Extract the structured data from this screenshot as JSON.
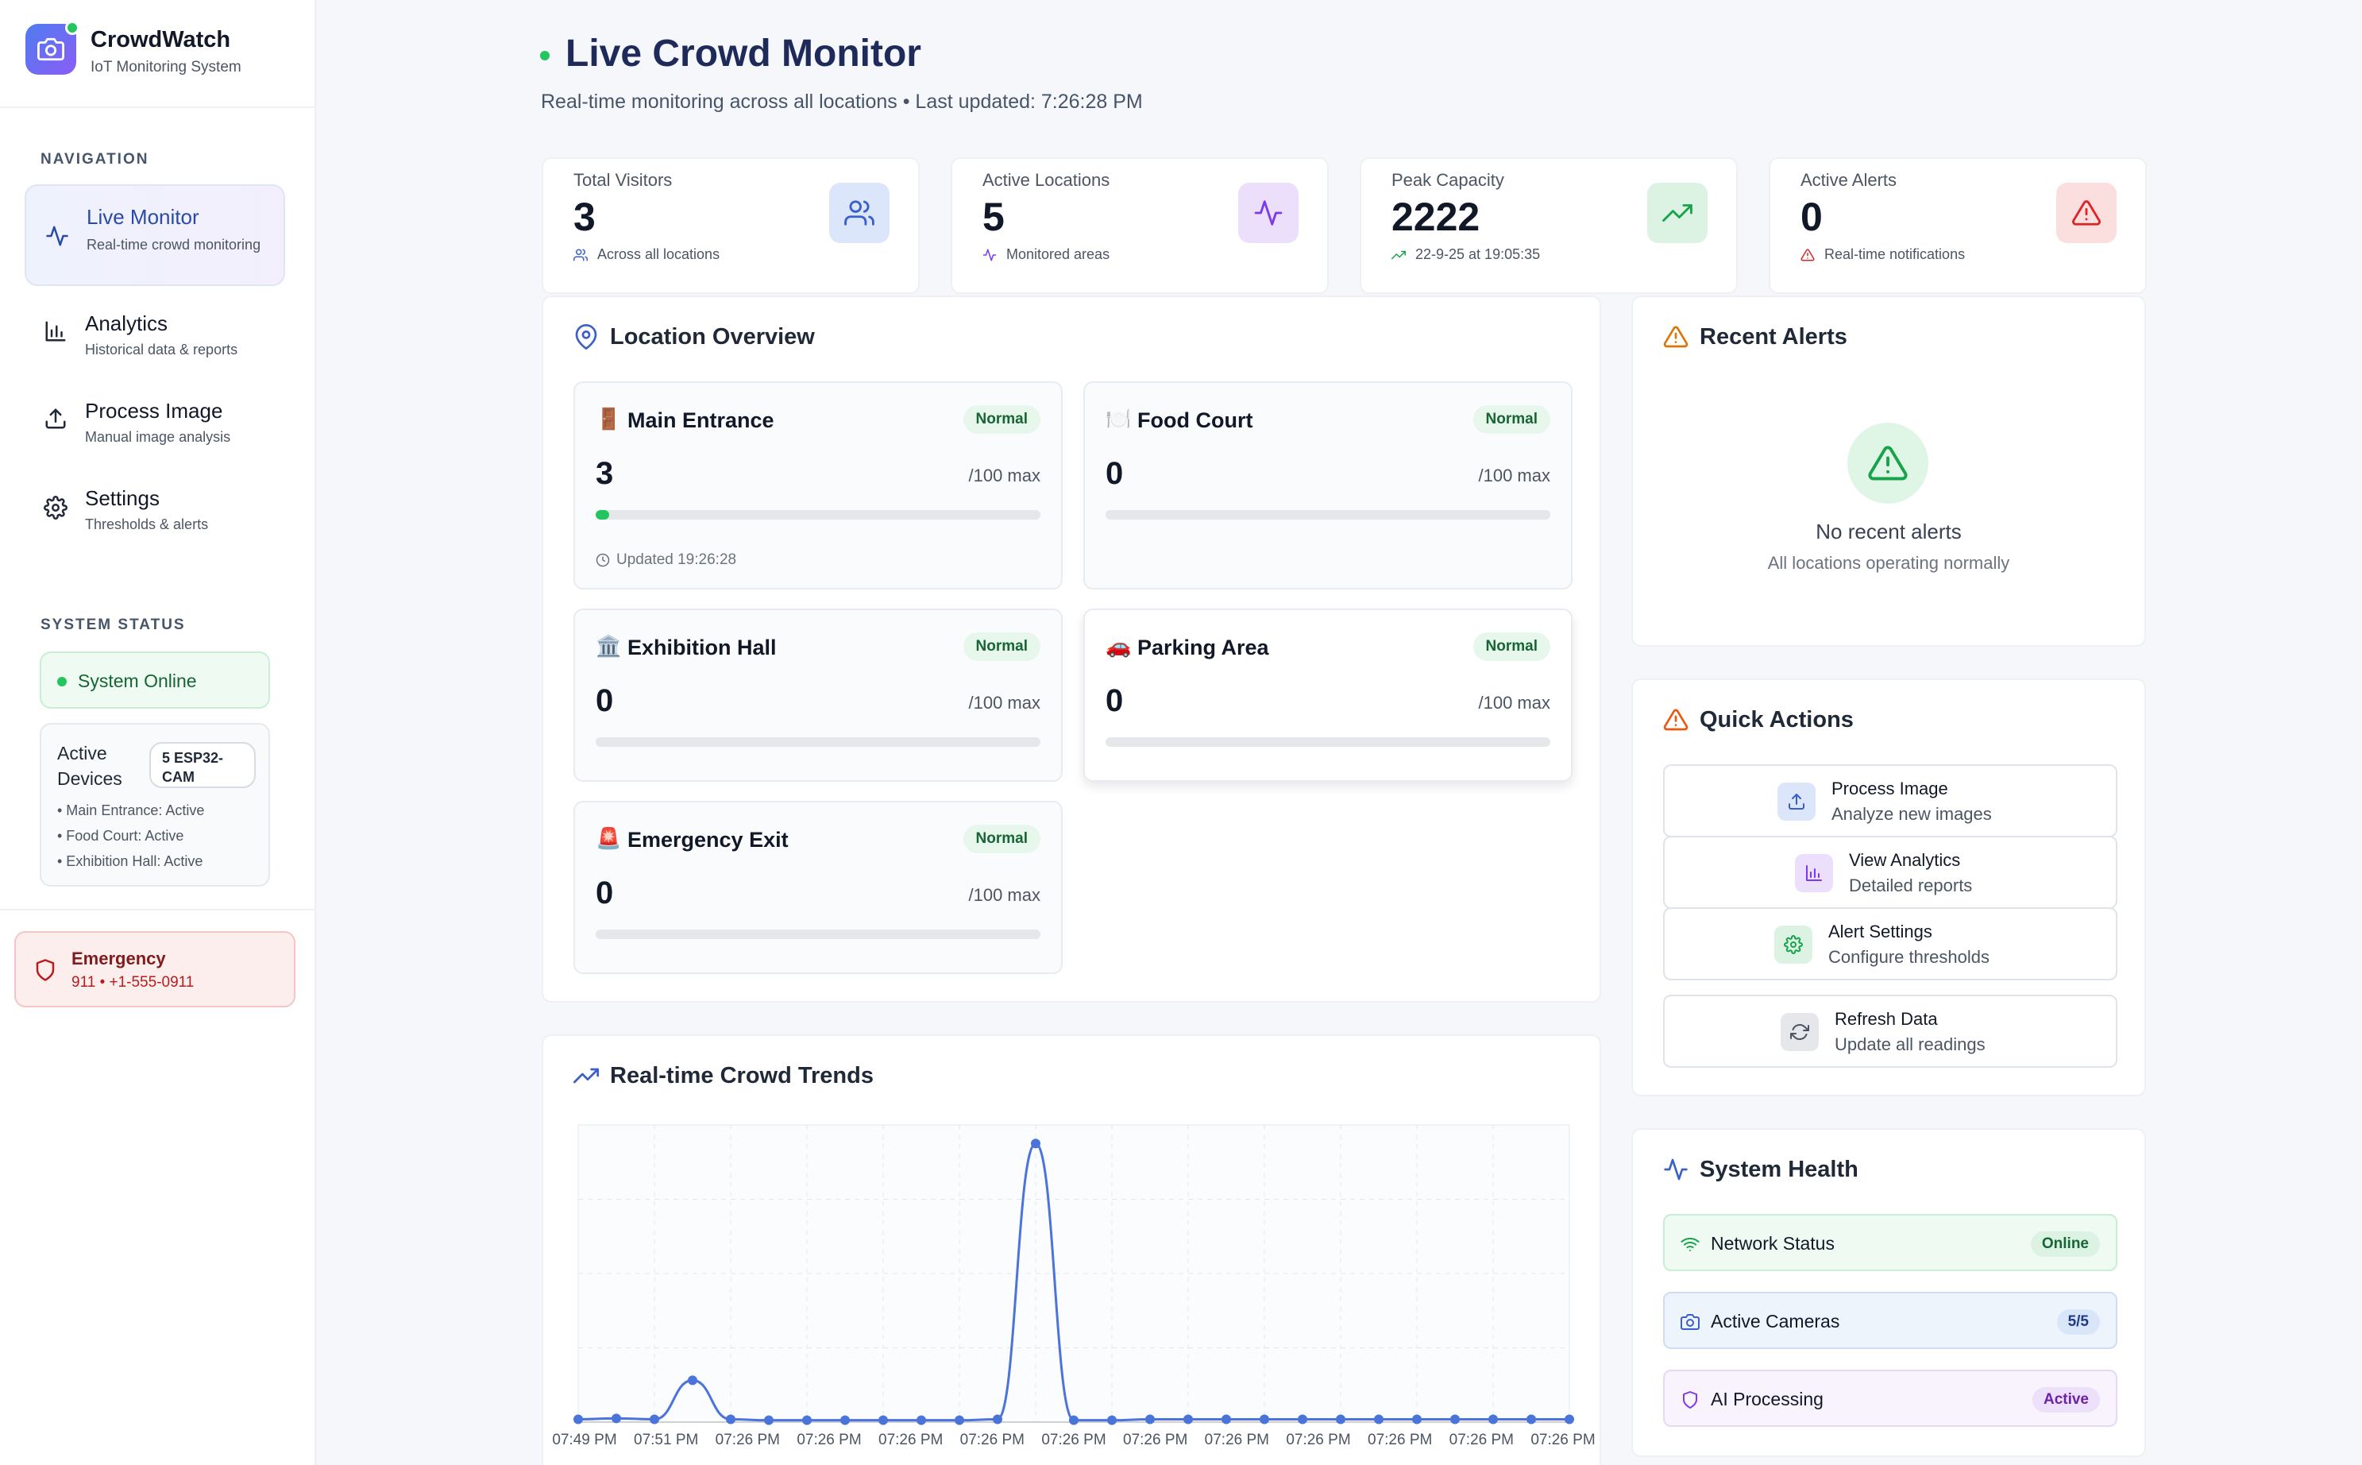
{
  "brand": {
    "title": "CrowdWatch",
    "subtitle": "IoT Monitoring System"
  },
  "sidebar": {
    "nav_label": "NAVIGATION",
    "items": [
      {
        "label": "Live Monitor",
        "desc": "Real-time crowd monitoring",
        "icon": "activity-icon",
        "active": true
      },
      {
        "label": "Analytics",
        "desc": "Historical data & reports",
        "icon": "bar-chart-icon",
        "active": false
      },
      {
        "label": "Process Image",
        "desc": "Manual image analysis",
        "icon": "upload-icon",
        "active": false
      },
      {
        "label": "Settings",
        "desc": "Thresholds & alerts",
        "icon": "gear-icon",
        "active": false
      }
    ],
    "status_label": "SYSTEM STATUS",
    "online_text": "System Online",
    "devices_title": "Active Devices",
    "devices_badge": "5 ESP32-CAM",
    "devices_lines": [
      "• Main Entrance: Active",
      "• Food Court: Active",
      "• Exhibition Hall: Active"
    ],
    "emergency_title": "Emergency",
    "emergency_numbers": "911 • +1-555-0911"
  },
  "header": {
    "title": "Live Crowd Monitor",
    "subtitle": "Real-time monitoring across all locations • Last updated: 7:26:28 PM"
  },
  "stats": [
    {
      "label": "Total Visitors",
      "value": "3",
      "foot": "Across all locations",
      "icon": "users-icon",
      "color": "#dbe6fb",
      "iconColor": "#3b5fc9"
    },
    {
      "label": "Active Locations",
      "value": "5",
      "foot": "Monitored areas",
      "icon": "activity-icon",
      "color": "#ebdffb",
      "iconColor": "#7c3aed"
    },
    {
      "label": "Peak Capacity",
      "value": "2222",
      "foot": "22-9-25 at 19:05:35",
      "icon": "trending-up-icon",
      "color": "#dcf3e4",
      "iconColor": "#16a34a"
    },
    {
      "label": "Active Alerts",
      "value": "0",
      "foot": "Real-time notifications",
      "icon": "alert-triangle-icon",
      "color": "#fbdede",
      "iconColor": "#dc2626"
    }
  ],
  "locations": {
    "title": "Location Overview",
    "items": [
      {
        "emoji": "🚪",
        "name": "Main Entrance",
        "status": "Normal",
        "count": "3",
        "max": "/100 max",
        "fill": 0.03,
        "updated": "Updated 19:26:28"
      },
      {
        "emoji": "🍽️",
        "name": "Food Court",
        "status": "Normal",
        "count": "0",
        "max": "/100 max",
        "fill": 0
      },
      {
        "emoji": "🏛️",
        "name": "Exhibition Hall",
        "status": "Normal",
        "count": "0",
        "max": "/100 max",
        "fill": 0
      },
      {
        "emoji": "🚗",
        "name": "Parking Area",
        "status": "Normal",
        "count": "0",
        "max": "/100 max",
        "fill": 0
      },
      {
        "emoji": "🚨",
        "name": "Emergency Exit",
        "status": "Normal",
        "count": "0",
        "max": "/100 max",
        "fill": 0
      }
    ]
  },
  "alerts": {
    "title": "Recent Alerts",
    "empty_title": "No recent alerts",
    "empty_sub": "All locations operating normally"
  },
  "quick_actions": {
    "title": "Quick Actions",
    "items": [
      {
        "label": "Process Image",
        "desc": "Analyze new images",
        "icon": "upload-icon",
        "color": "#dbe6fb",
        "iconColor": "#3b5fc9"
      },
      {
        "label": "View Analytics",
        "desc": "Detailed reports",
        "icon": "bar-chart-icon",
        "color": "#ebdffb",
        "iconColor": "#7c3aed"
      },
      {
        "label": "Alert Settings",
        "desc": "Configure thresholds",
        "icon": "gear-icon",
        "color": "#dcf3e4",
        "iconColor": "#16a34a"
      },
      {
        "label": "Refresh Data",
        "desc": "Update all readings",
        "icon": "refresh-icon",
        "color": "#e5e7eb",
        "iconColor": "#4b5563"
      }
    ]
  },
  "system_health": {
    "title": "System Health",
    "items": [
      {
        "label": "Network Status",
        "badge": "Online",
        "icon": "wifi-icon",
        "bg": "#effaf2",
        "border": "#c9eed5",
        "badgeBg": "#dcf3e4",
        "badgeColor": "#166534",
        "iconColor": "#16a34a"
      },
      {
        "label": "Active Cameras",
        "badge": "5/5",
        "icon": "camera-icon",
        "bg": "#eef4fc",
        "border": "#cfdcf1",
        "badgeBg": "#d9e5f9",
        "badgeColor": "#1e3a8a",
        "iconColor": "#3b5fc9"
      },
      {
        "label": "AI Processing",
        "badge": "Active",
        "icon": "shield-icon",
        "bg": "#f8f3fd",
        "border": "#e6d9f6",
        "badgeBg": "#ede0fb",
        "badgeColor": "#6b21a8",
        "iconColor": "#7c3aed"
      }
    ]
  },
  "trends": {
    "title": "Real-time Crowd Trends"
  },
  "chart_data": {
    "type": "line",
    "title": "Real-time Crowd Trends",
    "x": [
      "07:49 PM",
      "07:51 PM",
      "07:51 PM",
      "07:51 PM",
      "07:26 PM",
      "07:26 PM",
      "07:26 PM",
      "07:26 PM",
      "07:26 PM",
      "07:26 PM",
      "07:26 PM",
      "07:26 PM",
      "07:26 PM",
      "07:26 PM",
      "07:26 PM",
      "07:26 PM",
      "07:26 PM",
      "07:26 PM",
      "07:26 PM",
      "07:26 PM",
      "07:26 PM",
      "07:26 PM",
      "07:26 PM",
      "07:26 PM",
      "07:26 PM",
      "07:26 PM",
      "07:26 PM"
    ],
    "tick_labels": [
      "07:49 PM",
      "07:51 PM",
      "07:26 PM",
      "07:26 PM",
      "07:26 PM",
      "07:26 PM",
      "07:26 PM",
      "07:26 PM",
      "07:26 PM",
      "07:26 PM",
      "07:26 PM",
      "07:26 PM",
      "07:26 PM"
    ],
    "series": [
      {
        "values": [
          3,
          4,
          3,
          45,
          3,
          2,
          2,
          2,
          2,
          2,
          2,
          3,
          300,
          2,
          2,
          3,
          3,
          3,
          3,
          3,
          3,
          3,
          3,
          3,
          3,
          3,
          3
        ],
        "color": "#4a74d9"
      }
    ],
    "ylim": [
      0,
      320
    ],
    "grid": true,
    "legend": false
  }
}
